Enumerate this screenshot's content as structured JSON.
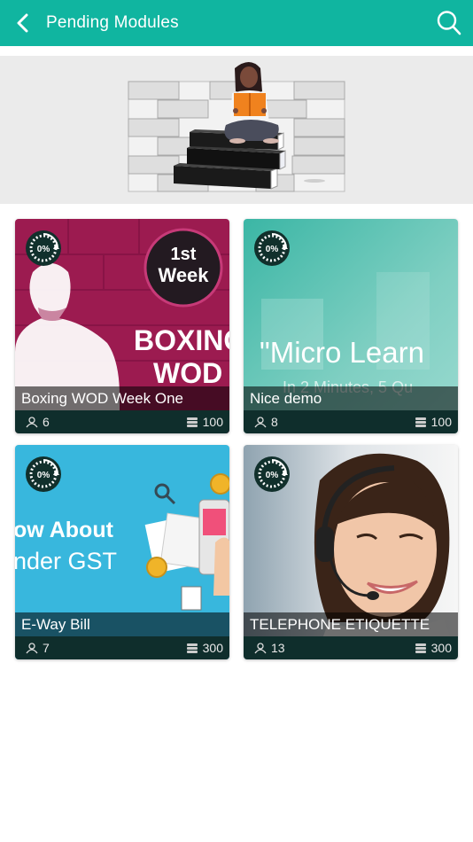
{
  "header": {
    "title": "Pending Modules",
    "back_icon": "back-arrow-icon",
    "search_icon": "search-icon",
    "bar_color": "#10b5a0"
  },
  "banner": {
    "image": "reading-girl-illustration"
  },
  "modules": [
    {
      "title": "Boxing WOD  Week One",
      "progress": "0%",
      "learners": "6",
      "points": "100",
      "thumb_text": [
        "1st",
        "Week",
        "BOXING",
        "WOD"
      ]
    },
    {
      "title": "Nice demo",
      "progress": "0%",
      "learners": "8",
      "points": "100",
      "thumb_text": [
        "\"Micro Learn",
        "In 2 Minutes, 5 Qu"
      ]
    },
    {
      "title": "E-Way Bill",
      "progress": "0%",
      "learners": "7",
      "points": "300",
      "thumb_text": [
        "ow About",
        "nder GST"
      ]
    },
    {
      "title": "TELEPHONE ETIQUETTE",
      "progress": "0%",
      "learners": "13",
      "points": "300"
    }
  ]
}
